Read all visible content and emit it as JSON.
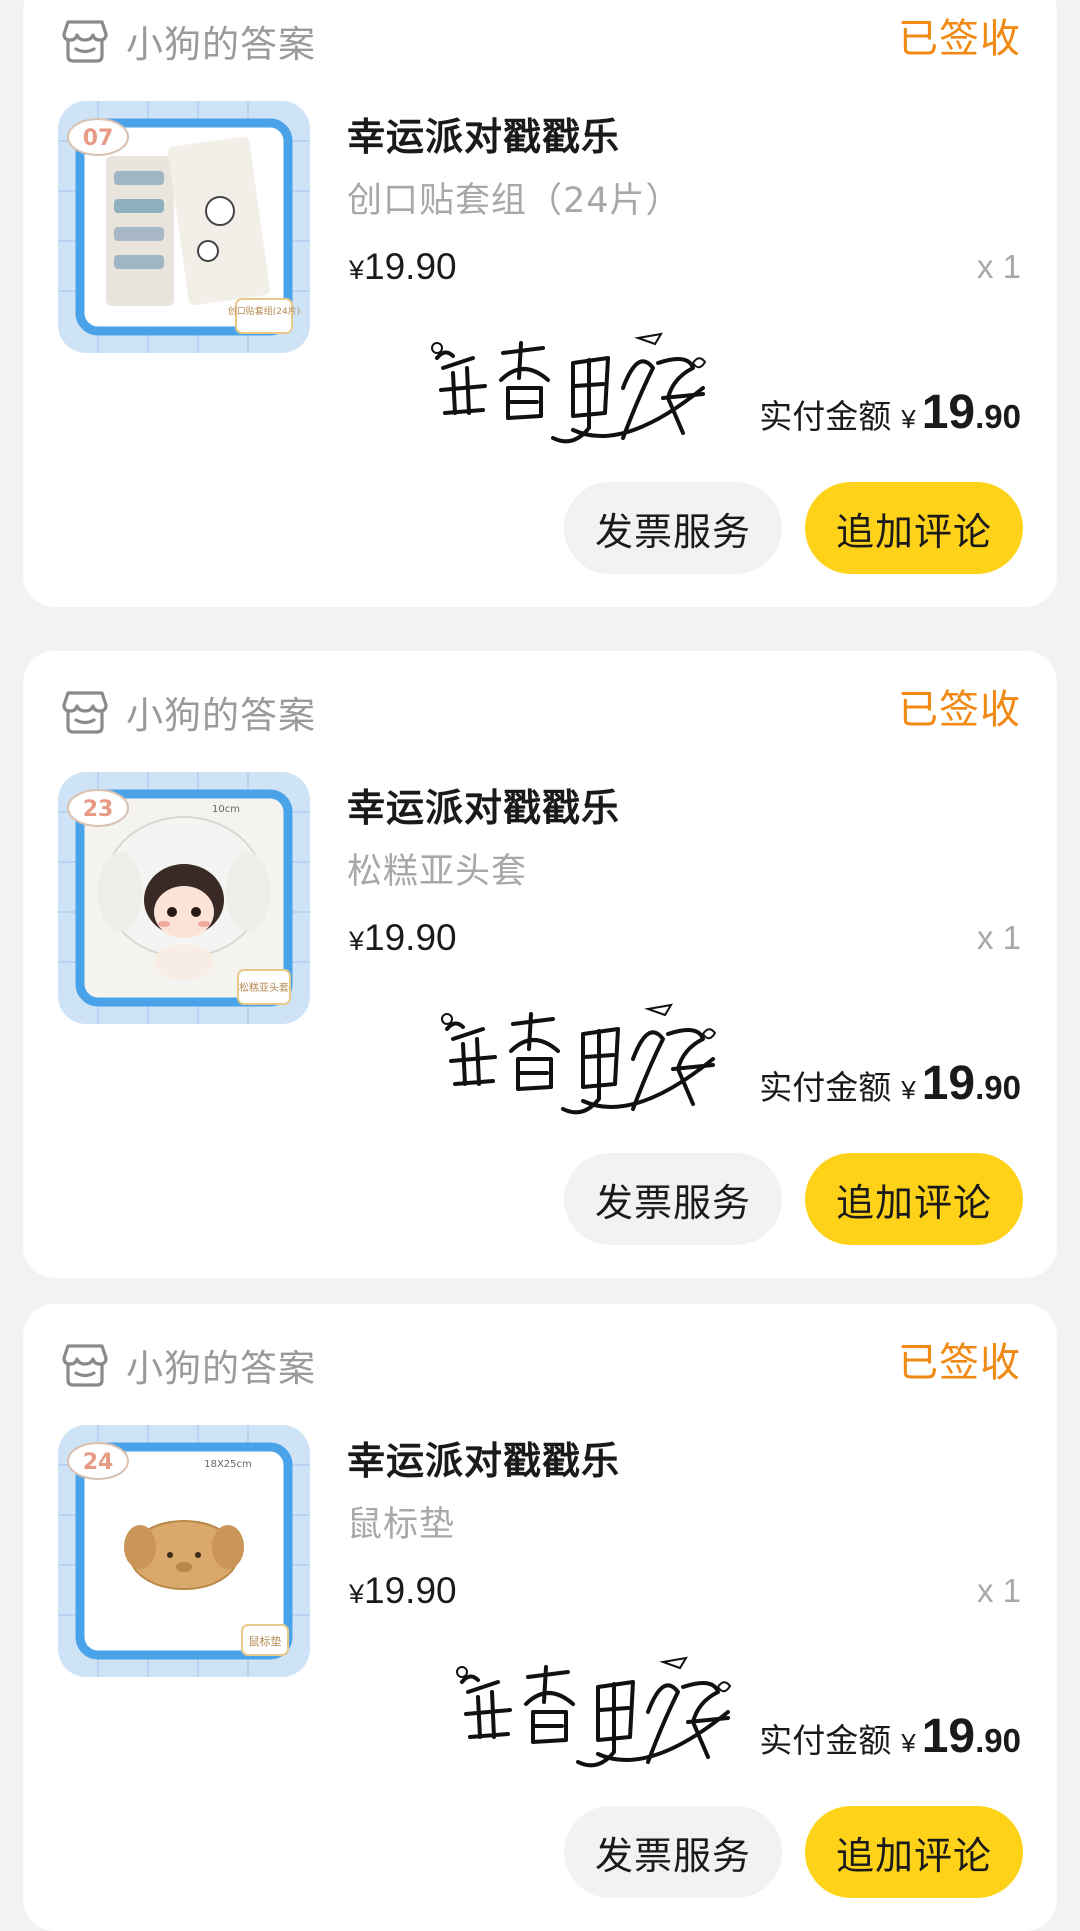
{
  "orders": [
    {
      "shop_name": "小狗的答案",
      "status": "已签收",
      "title": "幸运派对戳戳乐",
      "sku": "创口贴套组（24片）",
      "price_symbol": "¥",
      "price": "19.90",
      "quantity": "x 1",
      "paid_label": "实付金额",
      "paid_symbol": "¥",
      "paid_int": "19",
      "paid_dec": ".90",
      "invoice_label": "发票服务",
      "review_label": "追加评论",
      "thumb": {
        "number": "07",
        "size_tag": "",
        "corner_tag": "创口贴套组(24片)"
      },
      "watermark": "酱香鱼仔"
    },
    {
      "shop_name": "小狗的答案",
      "status": "已签收",
      "title": "幸运派对戳戳乐",
      "sku": "松糕亚头套",
      "price_symbol": "¥",
      "price": "19.90",
      "quantity": "x 1",
      "paid_label": "实付金额",
      "paid_symbol": "¥",
      "paid_int": "19",
      "paid_dec": ".90",
      "invoice_label": "发票服务",
      "review_label": "追加评论",
      "thumb": {
        "number": "23",
        "size_tag": "10cm",
        "corner_tag": "松糕亚头套"
      },
      "watermark": "酱香鱼仔"
    },
    {
      "shop_name": "小狗的答案",
      "status": "已签收",
      "title": "幸运派对戳戳乐",
      "sku": "鼠标垫",
      "price_symbol": "¥",
      "price": "19.90",
      "quantity": "x 1",
      "paid_label": "实付金额",
      "paid_symbol": "¥",
      "paid_int": "19",
      "paid_dec": ".90",
      "invoice_label": "发票服务",
      "review_label": "追加评论",
      "thumb": {
        "number": "24",
        "size_tag": "18X25cm",
        "corner_tag": "鼠标垫"
      },
      "watermark": "酱香鱼仔"
    }
  ],
  "colors": {
    "status": "#f08a15",
    "review_button": "#ffd21a",
    "invoice_button": "#f2f2f2",
    "card": "#ffffff",
    "page_bg": "#f2f2f2"
  },
  "icons": {
    "shop": "store-icon"
  }
}
